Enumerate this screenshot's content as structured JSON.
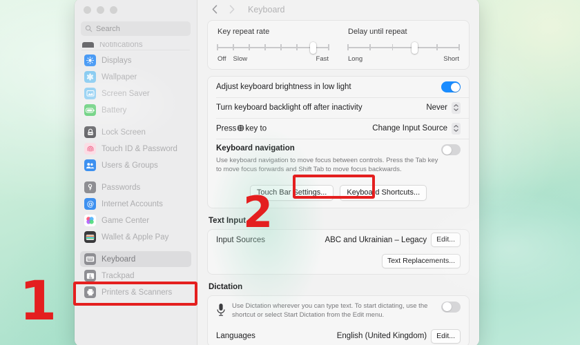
{
  "window": {
    "traffic_lights": [
      "close",
      "minimize",
      "zoom"
    ],
    "search": {
      "placeholder": "Search",
      "value": ""
    }
  },
  "sidebar": {
    "clipped_item": {
      "label": "Notifications",
      "icon": "notifications-icon"
    },
    "groups": [
      {
        "items": [
          {
            "label": "Displays",
            "icon": "displays-icon",
            "color": "#4a9bf5"
          },
          {
            "label": "Wallpaper",
            "icon": "wallpaper-icon",
            "color": "#7fc7f0"
          },
          {
            "label": "Screen Saver",
            "icon": "screen-saver-icon",
            "color": "#7fc7f0"
          },
          {
            "label": "Battery",
            "icon": "battery-icon",
            "color": "#4cc764"
          }
        ]
      },
      {
        "items": [
          {
            "label": "Lock Screen",
            "icon": "lock-screen-icon",
            "color": "#5c5c60"
          },
          {
            "label": "Touch ID & Password",
            "icon": "touch-id-icon",
            "color": "#f06d8e"
          },
          {
            "label": "Users & Groups",
            "icon": "users-groups-icon",
            "color": "#3d90f0"
          }
        ]
      },
      {
        "items": [
          {
            "label": "Passwords",
            "icon": "passwords-icon",
            "color": "#8e8e93"
          },
          {
            "label": "Internet Accounts",
            "icon": "internet-accounts-icon",
            "color": "#3d90f0"
          },
          {
            "label": "Game Center",
            "icon": "game-center-icon",
            "color": "#ffffff"
          },
          {
            "label": "Wallet & Apple Pay",
            "icon": "wallet-icon",
            "color": "#3a3a3c"
          }
        ]
      },
      {
        "items": [
          {
            "label": "Keyboard",
            "icon": "keyboard-icon",
            "color": "#8e8e93",
            "selected": true
          },
          {
            "label": "Trackpad",
            "icon": "trackpad-icon",
            "color": "#8e8e93"
          },
          {
            "label": "Printers & Scanners",
            "icon": "printers-icon",
            "color": "#8e8e93"
          }
        ]
      }
    ]
  },
  "detail": {
    "nav": {
      "back": "chevron-left-icon",
      "forward": "chevron-right-icon",
      "title": "Keyboard"
    },
    "key_repeat": {
      "title": "Key repeat rate",
      "ticks": 8,
      "value_index": 6,
      "label_off": "Off",
      "label_slow": "Slow",
      "label_fast": "Fast"
    },
    "delay_repeat": {
      "title": "Delay until repeat",
      "ticks": 6,
      "value_index": 3,
      "label_long": "Long",
      "label_short": "Short"
    },
    "rows": [
      {
        "label": "Adjust keyboard brightness in low light",
        "control": "toggle",
        "toggle_on": true
      },
      {
        "label": "Turn keyboard backlight off after inactivity",
        "control": "stepper",
        "value": "Never"
      },
      {
        "label_pre": "Press",
        "label_post": "key to",
        "icon": "globe-icon",
        "control": "stepper",
        "value": "Change Input Source"
      }
    ],
    "keyboard_navigation": {
      "title": "Keyboard navigation",
      "description": "Use keyboard navigation to move focus between controls. Press the Tab key to move focus forwards and Shift Tab to move focus backwards.",
      "toggle_on": false,
      "buttons": [
        "Touch Bar Settings...",
        "Keyboard Shortcuts..."
      ]
    },
    "text_input": {
      "heading": "Text Input",
      "input_sources_label": "Input Sources",
      "input_sources_value": "ABC and Ukrainian – Legacy",
      "edit_button": "Edit...",
      "text_replacements_button": "Text Replacements..."
    },
    "dictation": {
      "heading": "Dictation",
      "icon": "microphone-icon",
      "description": "Use Dictation wherever you can type text. To start dictating, use the shortcut or select Start Dictation from the Edit menu.",
      "toggle_on": false,
      "languages_label": "Languages",
      "languages_value": "English (United Kingdom)",
      "languages_edit": "Edit..."
    }
  },
  "annotations": {
    "step_one": "1",
    "step_two": "2",
    "color": "#e41f1f"
  }
}
